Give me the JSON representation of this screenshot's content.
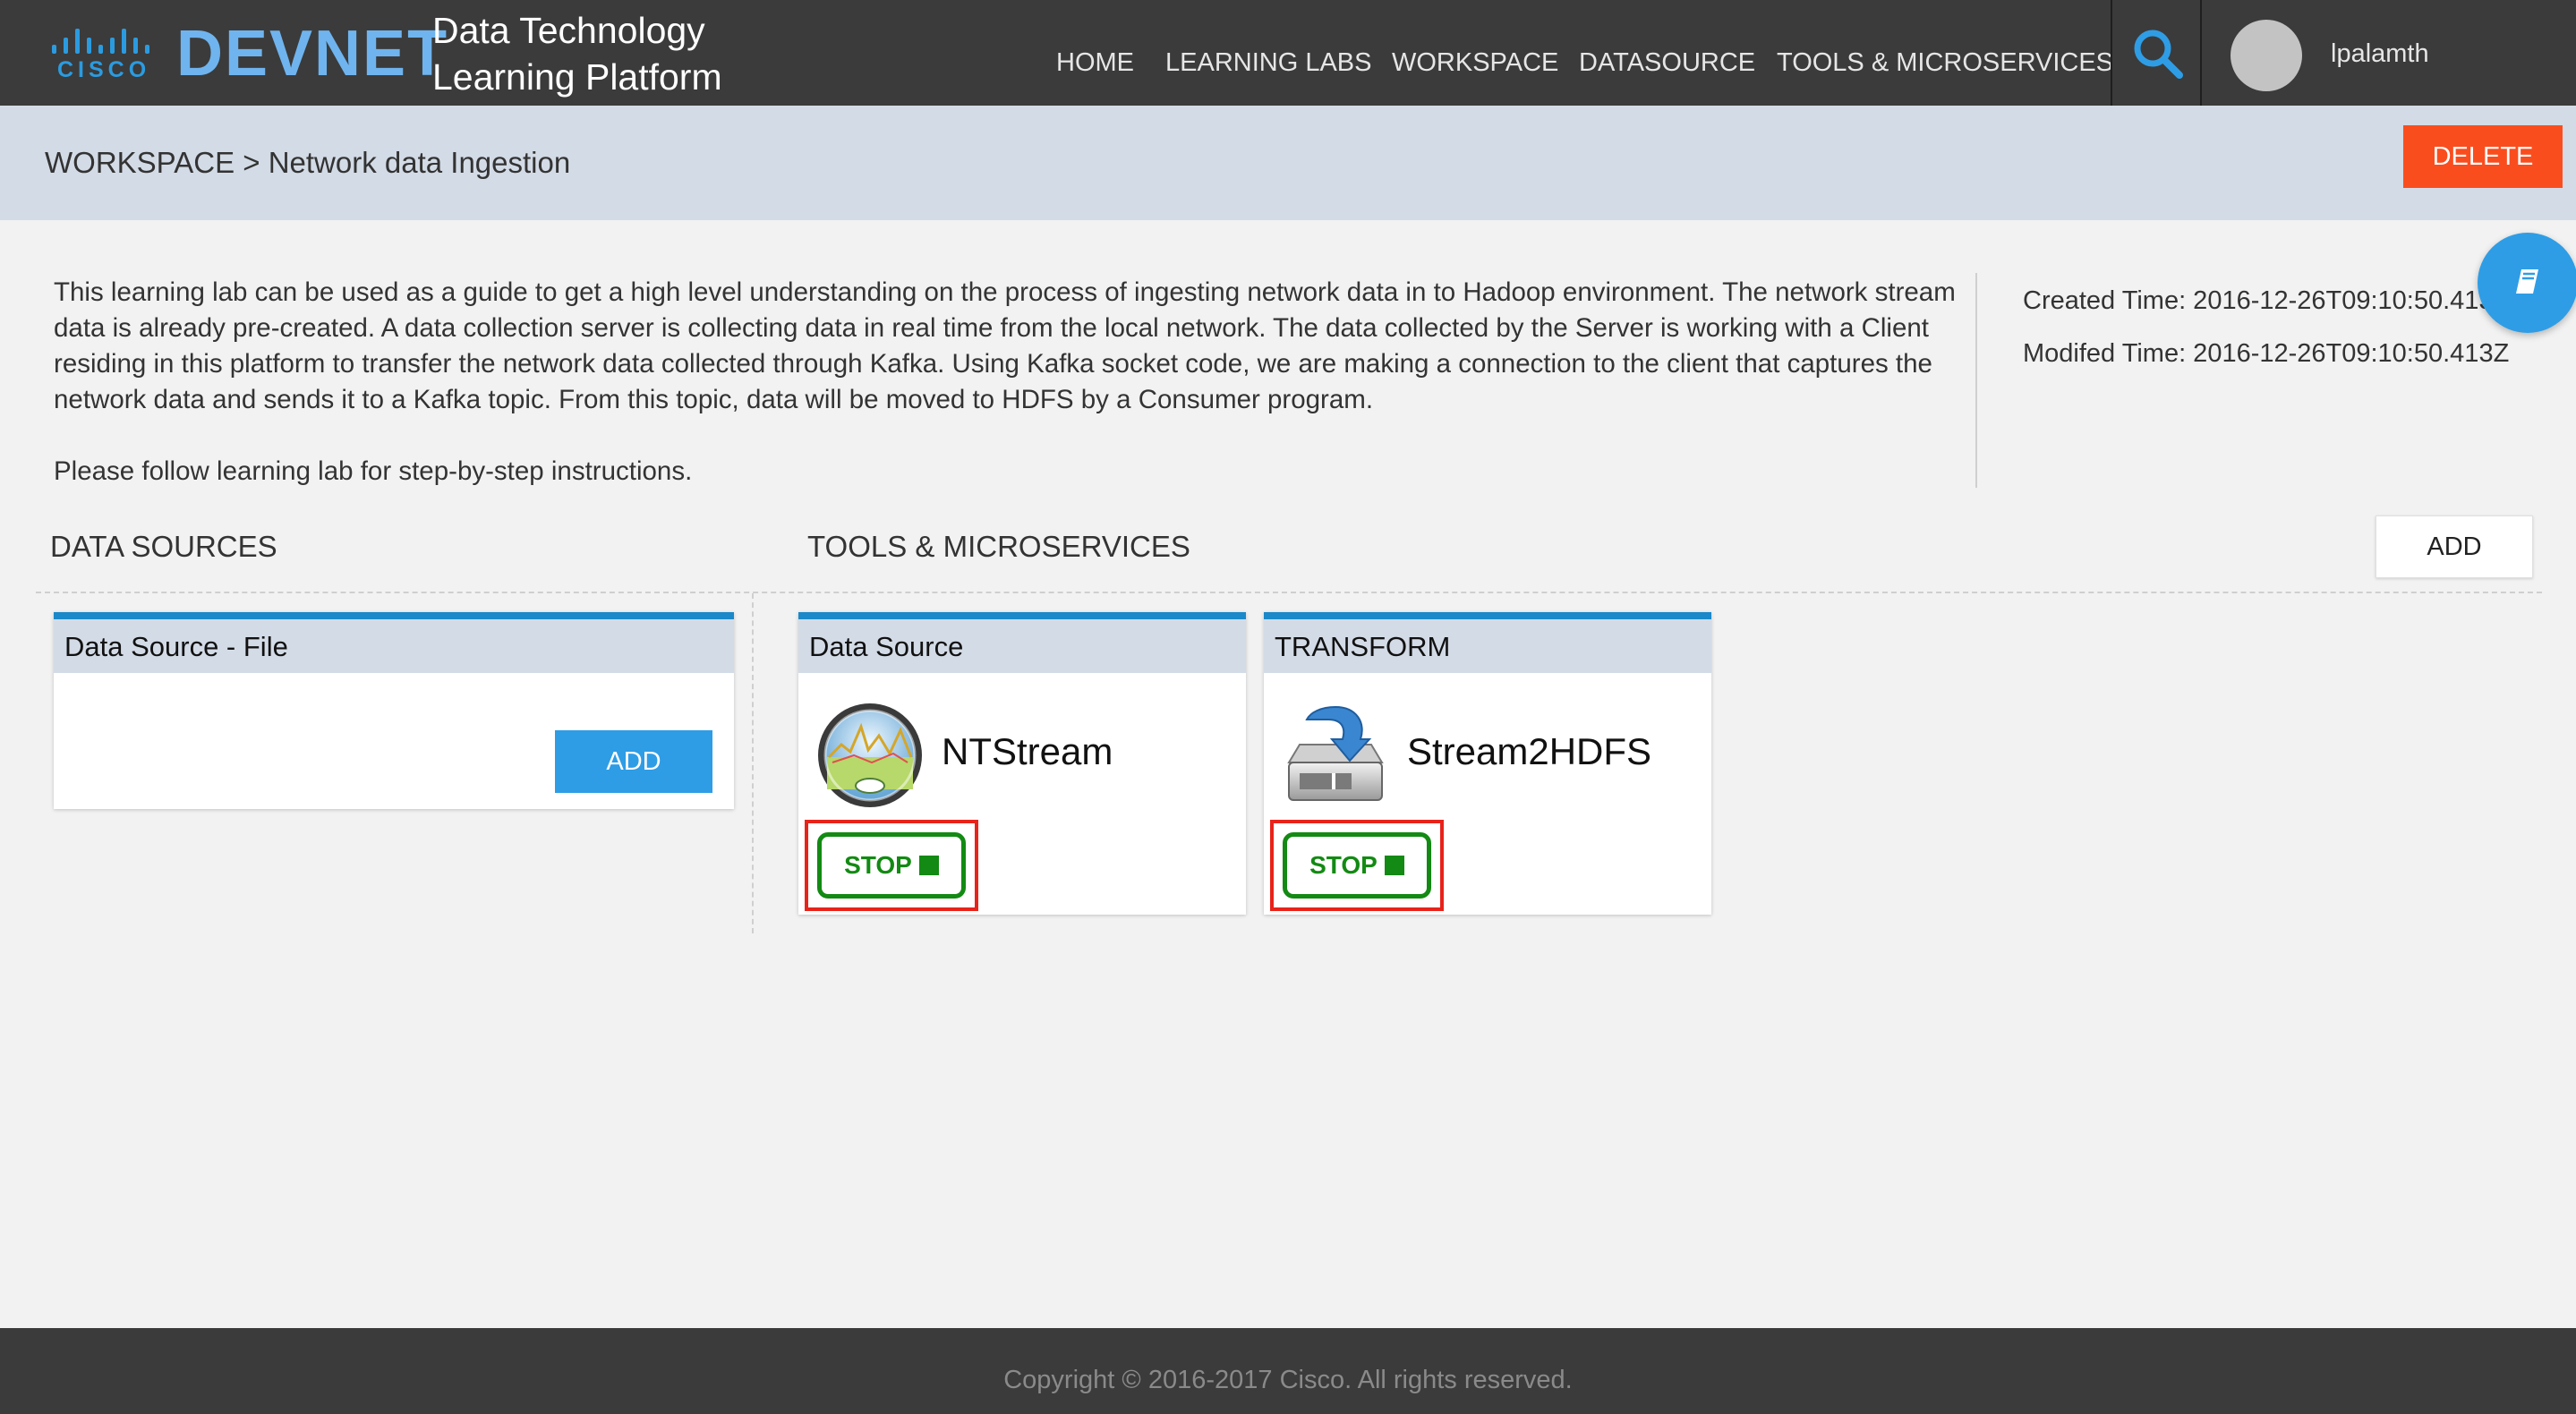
{
  "header": {
    "cisco_text": "CISCO",
    "devnet_text": "DEVNET",
    "platform_line1": "Data Technology",
    "platform_line2": "Learning Platform",
    "nav": [
      "HOME",
      "LEARNING LABS",
      "WORKSPACE",
      "DATASOURCE",
      "TOOLS & MICROSERVICES"
    ],
    "search_icon": "search-icon",
    "username": "lpalamth"
  },
  "breadcrumb": {
    "text": "WORKSPACE > Network data Ingestion",
    "delete_label": "DELETE"
  },
  "description": {
    "paragraph1": "This learning lab can be used as a guide to get a high level understanding on the process of ingesting network data in to Hadoop environment. The network stream data is already pre-created. A data collection server is collecting data in real time from the local network. The data collected by the Server is working with a Client residing in this platform to transfer the network data collected through Kafka. Using Kafka socket code, we are making a connection to the client that captures the network data and sends it to a Kafka topic. From this topic, data will be moved to HDFS by a Consumer program.",
    "paragraph2": "Please follow learning lab for step-by-step instructions."
  },
  "meta": {
    "created": "Created Time: 2016-12-26T09:10:50.413Z",
    "modified": "Modifed Time: 2016-12-26T09:10:50.413Z"
  },
  "sections": {
    "data_sources_title": "DATA SOURCES",
    "tools_title": "TOOLS & MICROSERVICES",
    "tools_add_label": "ADD"
  },
  "data_source_card": {
    "title": "Data Source - File",
    "add_label": "ADD"
  },
  "tool_cards": [
    {
      "type": "Data Source",
      "name": "NTStream",
      "icon": "network-meter-icon",
      "stop_label": "STOP"
    },
    {
      "type": "TRANSFORM",
      "name": "Stream2HDFS",
      "icon": "disk-download-icon",
      "stop_label": "STOP"
    }
  ],
  "footer": {
    "copyright": "Copyright © 2016-2017 Cisco. All rights reserved."
  },
  "colors": {
    "header_bg": "#3b3b3b",
    "accent_blue": "#2e9de6",
    "delete_orange": "#fa4d1e",
    "stop_green": "#138a13",
    "highlight_red": "#e8231a"
  }
}
